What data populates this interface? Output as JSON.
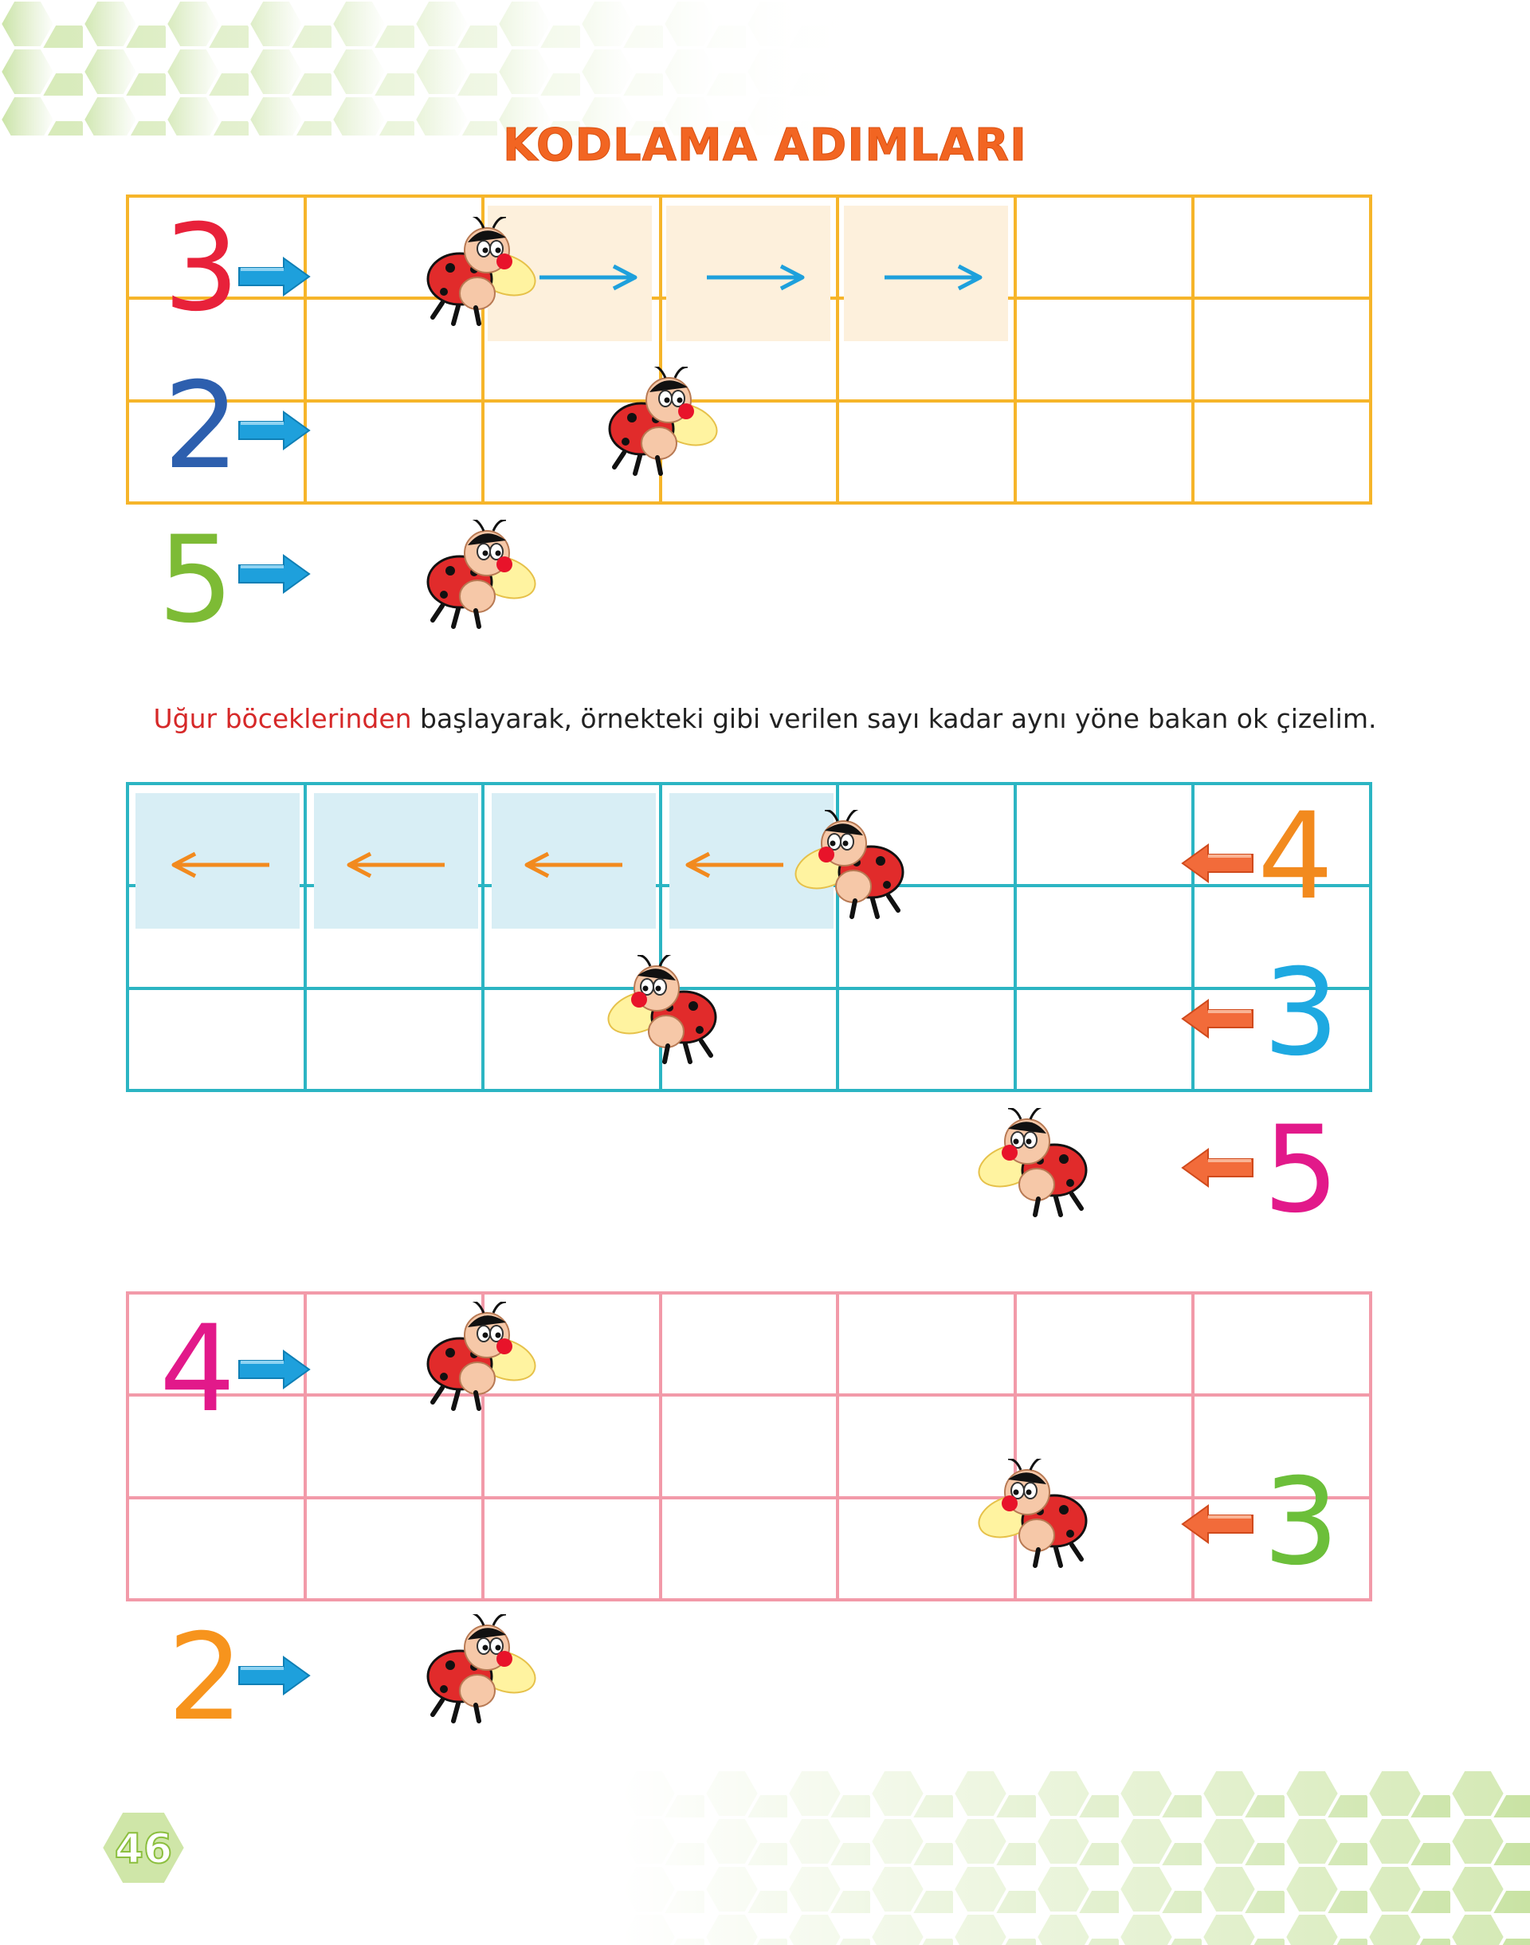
{
  "title": "KODLAMA ADIMLARI",
  "instruction": {
    "highlight": "Uğur böceklerinden",
    "rest": " başlayarak, örnekteki gibi verilen sayı kadar aynı yöne bakan ok çizelim."
  },
  "grids": [
    {
      "name": "example-grid",
      "rows": [
        {
          "number": "3",
          "color": "#e8213a",
          "direction": "right"
        },
        {
          "number": "2",
          "color": "#2d5fae",
          "direction": "right"
        },
        {
          "number": "5",
          "color": "#7dbb35",
          "direction": "right"
        }
      ]
    },
    {
      "name": "left-grid",
      "rows": [
        {
          "number": "4",
          "color": "#f28a1e",
          "direction": "left"
        },
        {
          "number": "3",
          "color": "#1ea9e1",
          "direction": "left"
        },
        {
          "number": "5",
          "color": "#e2198a",
          "direction": "left"
        }
      ]
    },
    {
      "name": "mixed-grid",
      "rows": [
        {
          "number": "4",
          "color": "#e2198a",
          "direction": "right"
        },
        {
          "number": "3",
          "color": "#6cbf3a",
          "direction": "left"
        },
        {
          "number": "2",
          "color": "#f7941d",
          "direction": "right"
        }
      ]
    }
  ],
  "colors": {
    "yellow_grid": "#f6b52a",
    "blue_grid": "#2cb5c3",
    "pink_grid": "#f29aa9",
    "title": "#f26522",
    "blue_arrow": "#1ea0dc",
    "orange_arrow": "#f28a1e"
  },
  "page_number": "46"
}
